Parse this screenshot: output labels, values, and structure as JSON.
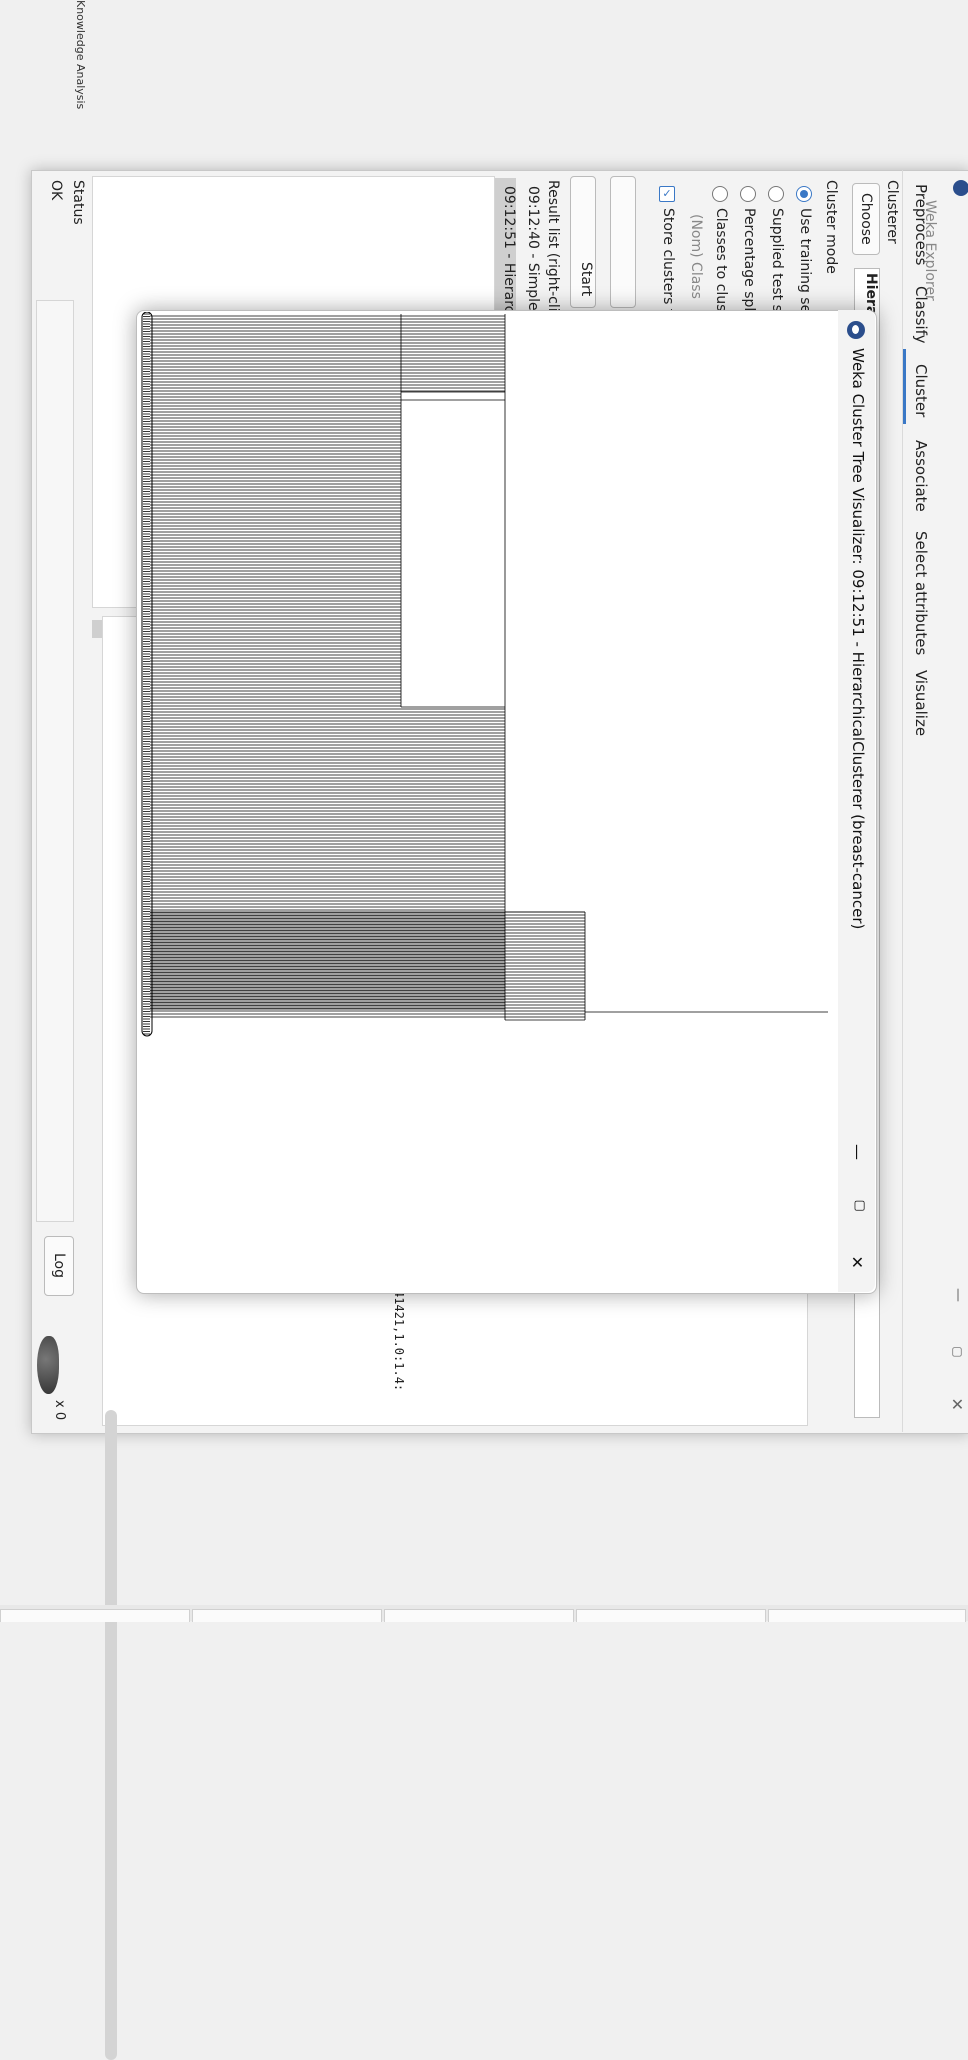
{
  "desktop": {
    "label": "Knowledge Analysis"
  },
  "explorer": {
    "title": "Weka Explorer",
    "window_controls": {
      "minimize": "—",
      "maximize": "▢",
      "close": "✕"
    },
    "tabs": [
      "Preprocess",
      "Classify",
      "Cluster",
      "Associate",
      "Select attributes",
      "Visualize"
    ],
    "active_tab": "Cluster",
    "clusterer": {
      "label": "Clusterer",
      "choose_label": "Choose",
      "algorithm": "Hiera"
    },
    "cluster_mode": {
      "label": "Cluster mode",
      "options": [
        {
          "label": "Use training set",
          "selected": true
        },
        {
          "label": "Supplied test se",
          "selected": false
        },
        {
          "label": "Percentage spli",
          "selected": false
        },
        {
          "label": "Classes to clust",
          "selected": false
        }
      ],
      "class_select": "(Nom) Class",
      "store_clusters": "Store clusters fo"
    },
    "start_label": "Start",
    "result_list": {
      "label": "Result list (right-clic",
      "items": [
        "09:12:40 - SimpleK",
        "09:12:51 - Hierarch"
      ]
    },
    "output_text": "41421,1.0:1.4:",
    "status": {
      "label": "Status",
      "text": "OK",
      "log_label": "Log",
      "count": "x 0"
    }
  },
  "dialog": {
    "title": "Weka Cluster Tree Visualizer: 09:12:51 - HierarchicalClusterer (breast-cancer)",
    "window_controls": {
      "minimize": "—",
      "maximize": "▢",
      "close": "✕"
    }
  },
  "colors": {
    "accent": "#3a78c6",
    "tree_stroke": "#000000"
  }
}
